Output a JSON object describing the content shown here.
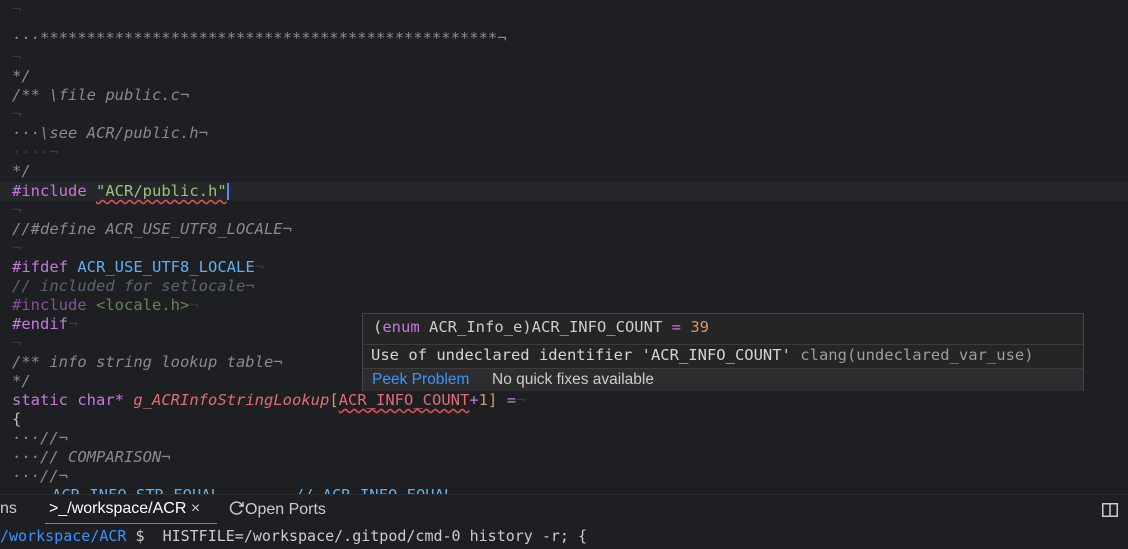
{
  "editor": {
    "lines": [
      {
        "id": "l0",
        "t": "¬"
      },
      {
        "id": "l1",
        "t": "···*************************************************¬"
      },
      {
        "id": "l2",
        "t": "¬"
      },
      {
        "id": "l3",
        "t": "*/"
      },
      {
        "id": "l4",
        "t": "/** \\file public.c¬"
      },
      {
        "id": "l5",
        "t": "¬"
      },
      {
        "id": "l6",
        "t": "···\\see ACR/public.h¬"
      },
      {
        "id": "l7",
        "t": "····¬"
      },
      {
        "id": "l8",
        "t": "*/"
      }
    ],
    "include_kw": "#include",
    "include_str": "\"ACR/public.h\"",
    "blank_mark": "¬",
    "define_comment": "//#define ACR_USE_UTF8_LOCALE¬",
    "ifdef_kw": "#ifdef",
    "ifdef_macro": "ACR_USE_UTF8_LOCALE",
    "included_comment": "// included for setlocale¬",
    "include2_kw": "#include",
    "include2_hdr": "<locale.h>",
    "endif_kw": "#endif",
    "info_comment": "/** info string lookup table¬",
    "info_close": "*/",
    "static_kw": "static",
    "char_kw": "char*",
    "var_name": "g_ACRInfoStringLookup",
    "bracket_open": "[",
    "array_size_id": "ACR_INFO_COUNT",
    "plus": "+",
    "one": "1",
    "bracket_close": "]",
    "assign": "=",
    "brace": "{",
    "c1": "···//¬",
    "c2": "···// COMPARISON¬",
    "c3": "···//¬",
    "cut_line": "ACR_INFO_STR_EQUAL        // ACR_INFO_EQUAL"
  },
  "hover": {
    "sig_open": "(",
    "sig_enum": "enum",
    "sig_type": " ACR_Info_e)ACR_INFO_COUNT ",
    "sig_eq": "=",
    "sig_value": "39",
    "message": "Use of undeclared identifier 'ACR_INFO_COUNT'",
    "source": "clang(undeclared_var_use)",
    "peek_label": "Peek Problem",
    "nofix_label": "No quick fixes available"
  },
  "panel": {
    "tab_partial": "ns",
    "terminal_tab": "_/workspace/ACR",
    "terminal_prompt_icon": ">",
    "close": "×",
    "ports_tab": "Open Ports"
  },
  "terminal": {
    "path": "/workspace/ACR",
    "prompt": " $  ",
    "command": "HISTFILE=/workspace/.gitpod/cmd-0 history -r; {"
  },
  "colors": {
    "accent": "#3794ff",
    "error_squiggle": "#e05252"
  }
}
